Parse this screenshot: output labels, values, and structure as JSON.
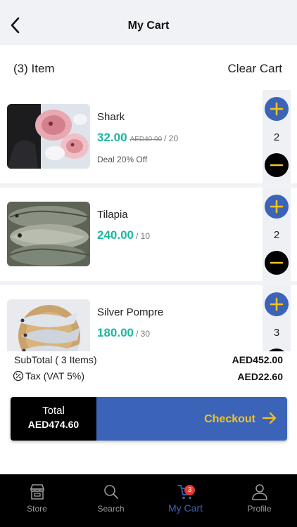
{
  "header": {
    "title": "My Cart",
    "back_icon": "chevron-left-icon"
  },
  "cart_bar": {
    "item_count": "(3) Item",
    "clear_label": "Clear Cart"
  },
  "items": [
    {
      "name": "Shark",
      "price": "32.00",
      "old_price": "AED40.00",
      "unit": "/ 20",
      "deal": "Deal 20% Off",
      "quantity": "2"
    },
    {
      "name": "Tilapia",
      "price": "240.00",
      "unit": "/ 10",
      "quantity": "2"
    },
    {
      "name": "Silver Pompre",
      "price": "180.00",
      "unit": "/ 30",
      "quantity": "3"
    }
  ],
  "summary": {
    "subtotal_label": "SubTotal ( 3 Items)",
    "subtotal_value": "AED452.00",
    "tax_label": "Tax (VAT 5%)",
    "tax_value": "AED22.60"
  },
  "checkout": {
    "total_label": "Total",
    "total_value": "AED474.60",
    "button_label": "Checkout"
  },
  "tabs": [
    {
      "label": "Store",
      "icon": "store-icon"
    },
    {
      "label": "Search",
      "icon": "search-icon"
    },
    {
      "label": "My Cart",
      "icon": "cart-icon",
      "badge": "3",
      "active": true
    },
    {
      "label": "Profile",
      "icon": "profile-icon"
    }
  ],
  "colors": {
    "accent": "#3b64b8",
    "price": "#19b7a0",
    "checkout_text": "#f6c21c",
    "badge": "#e23a2e"
  }
}
